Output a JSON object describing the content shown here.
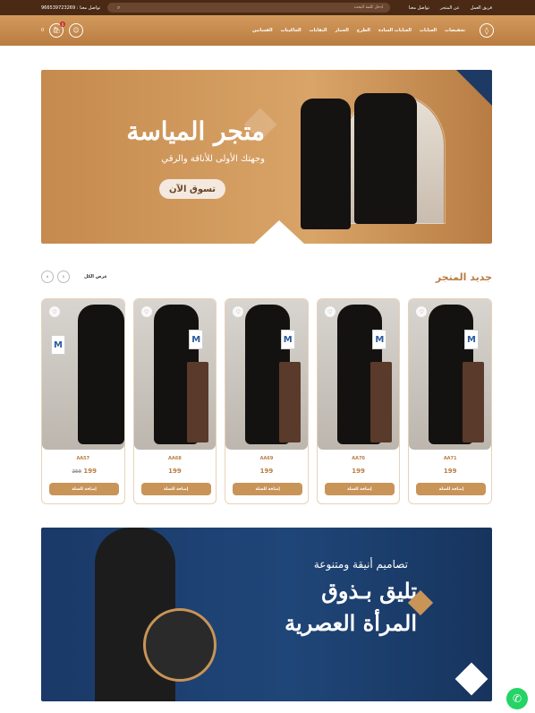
{
  "topbar": {
    "links": [
      "فريق العمل",
      "عن المتجر",
      "تواصل معنا"
    ],
    "search_placeholder": "ادخل كلمة البحث",
    "contact_label": "تواصل معنا",
    "phone": "966539723269"
  },
  "nav": {
    "menu": [
      "تخفيضات",
      "العبايات",
      "العبايات السادة",
      "الطرح",
      "الخمار",
      "النقابات",
      "الجاكيتات",
      "الفساتين"
    ],
    "cart_total": "0",
    "cart_count": "0"
  },
  "banner1": {
    "title": "متجر المياسة",
    "subtitle": "وجهتك الأولى للأناقة والرقي",
    "cta": "تسوق الآن"
  },
  "section": {
    "title": "جديد المتجر",
    "view_all": "عرض الكل"
  },
  "products": [
    {
      "code": "AA57",
      "price": "199",
      "old_price": "250"
    },
    {
      "code": "AA68",
      "price": "199",
      "old_price": ""
    },
    {
      "code": "AA69",
      "price": "199",
      "old_price": ""
    },
    {
      "code": "AA70",
      "price": "199",
      "old_price": ""
    },
    {
      "code": "AA71",
      "price": "199",
      "old_price": ""
    }
  ],
  "add_to_cart_label": "إضافة للسلة",
  "banner2": {
    "line1": "تصاميم أنيقة ومتنوعة",
    "line2": "تليق بـذوق",
    "line3": "المرأة العصرية"
  },
  "colors": {
    "brand": "#b97c41",
    "dark": "#4a2a14",
    "navy": "#1d3a64"
  }
}
